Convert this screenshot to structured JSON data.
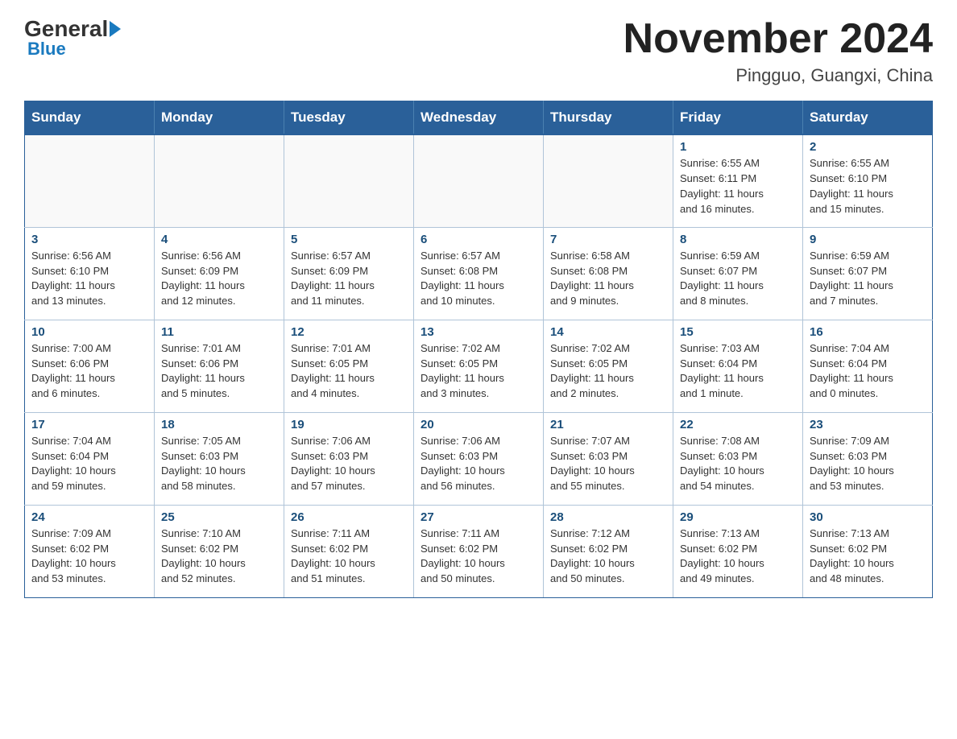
{
  "header": {
    "logo_general": "General",
    "logo_blue": "Blue",
    "main_title": "November 2024",
    "subtitle": "Pingguo, Guangxi, China"
  },
  "weekdays": [
    "Sunday",
    "Monday",
    "Tuesday",
    "Wednesday",
    "Thursday",
    "Friday",
    "Saturday"
  ],
  "weeks": [
    [
      {
        "day": "",
        "info": ""
      },
      {
        "day": "",
        "info": ""
      },
      {
        "day": "",
        "info": ""
      },
      {
        "day": "",
        "info": ""
      },
      {
        "day": "",
        "info": ""
      },
      {
        "day": "1",
        "info": "Sunrise: 6:55 AM\nSunset: 6:11 PM\nDaylight: 11 hours\nand 16 minutes."
      },
      {
        "day": "2",
        "info": "Sunrise: 6:55 AM\nSunset: 6:10 PM\nDaylight: 11 hours\nand 15 minutes."
      }
    ],
    [
      {
        "day": "3",
        "info": "Sunrise: 6:56 AM\nSunset: 6:10 PM\nDaylight: 11 hours\nand 13 minutes."
      },
      {
        "day": "4",
        "info": "Sunrise: 6:56 AM\nSunset: 6:09 PM\nDaylight: 11 hours\nand 12 minutes."
      },
      {
        "day": "5",
        "info": "Sunrise: 6:57 AM\nSunset: 6:09 PM\nDaylight: 11 hours\nand 11 minutes."
      },
      {
        "day": "6",
        "info": "Sunrise: 6:57 AM\nSunset: 6:08 PM\nDaylight: 11 hours\nand 10 minutes."
      },
      {
        "day": "7",
        "info": "Sunrise: 6:58 AM\nSunset: 6:08 PM\nDaylight: 11 hours\nand 9 minutes."
      },
      {
        "day": "8",
        "info": "Sunrise: 6:59 AM\nSunset: 6:07 PM\nDaylight: 11 hours\nand 8 minutes."
      },
      {
        "day": "9",
        "info": "Sunrise: 6:59 AM\nSunset: 6:07 PM\nDaylight: 11 hours\nand 7 minutes."
      }
    ],
    [
      {
        "day": "10",
        "info": "Sunrise: 7:00 AM\nSunset: 6:06 PM\nDaylight: 11 hours\nand 6 minutes."
      },
      {
        "day": "11",
        "info": "Sunrise: 7:01 AM\nSunset: 6:06 PM\nDaylight: 11 hours\nand 5 minutes."
      },
      {
        "day": "12",
        "info": "Sunrise: 7:01 AM\nSunset: 6:05 PM\nDaylight: 11 hours\nand 4 minutes."
      },
      {
        "day": "13",
        "info": "Sunrise: 7:02 AM\nSunset: 6:05 PM\nDaylight: 11 hours\nand 3 minutes."
      },
      {
        "day": "14",
        "info": "Sunrise: 7:02 AM\nSunset: 6:05 PM\nDaylight: 11 hours\nand 2 minutes."
      },
      {
        "day": "15",
        "info": "Sunrise: 7:03 AM\nSunset: 6:04 PM\nDaylight: 11 hours\nand 1 minute."
      },
      {
        "day": "16",
        "info": "Sunrise: 7:04 AM\nSunset: 6:04 PM\nDaylight: 11 hours\nand 0 minutes."
      }
    ],
    [
      {
        "day": "17",
        "info": "Sunrise: 7:04 AM\nSunset: 6:04 PM\nDaylight: 10 hours\nand 59 minutes."
      },
      {
        "day": "18",
        "info": "Sunrise: 7:05 AM\nSunset: 6:03 PM\nDaylight: 10 hours\nand 58 minutes."
      },
      {
        "day": "19",
        "info": "Sunrise: 7:06 AM\nSunset: 6:03 PM\nDaylight: 10 hours\nand 57 minutes."
      },
      {
        "day": "20",
        "info": "Sunrise: 7:06 AM\nSunset: 6:03 PM\nDaylight: 10 hours\nand 56 minutes."
      },
      {
        "day": "21",
        "info": "Sunrise: 7:07 AM\nSunset: 6:03 PM\nDaylight: 10 hours\nand 55 minutes."
      },
      {
        "day": "22",
        "info": "Sunrise: 7:08 AM\nSunset: 6:03 PM\nDaylight: 10 hours\nand 54 minutes."
      },
      {
        "day": "23",
        "info": "Sunrise: 7:09 AM\nSunset: 6:03 PM\nDaylight: 10 hours\nand 53 minutes."
      }
    ],
    [
      {
        "day": "24",
        "info": "Sunrise: 7:09 AM\nSunset: 6:02 PM\nDaylight: 10 hours\nand 53 minutes."
      },
      {
        "day": "25",
        "info": "Sunrise: 7:10 AM\nSunset: 6:02 PM\nDaylight: 10 hours\nand 52 minutes."
      },
      {
        "day": "26",
        "info": "Sunrise: 7:11 AM\nSunset: 6:02 PM\nDaylight: 10 hours\nand 51 minutes."
      },
      {
        "day": "27",
        "info": "Sunrise: 7:11 AM\nSunset: 6:02 PM\nDaylight: 10 hours\nand 50 minutes."
      },
      {
        "day": "28",
        "info": "Sunrise: 7:12 AM\nSunset: 6:02 PM\nDaylight: 10 hours\nand 50 minutes."
      },
      {
        "day": "29",
        "info": "Sunrise: 7:13 AM\nSunset: 6:02 PM\nDaylight: 10 hours\nand 49 minutes."
      },
      {
        "day": "30",
        "info": "Sunrise: 7:13 AM\nSunset: 6:02 PM\nDaylight: 10 hours\nand 48 minutes."
      }
    ]
  ]
}
